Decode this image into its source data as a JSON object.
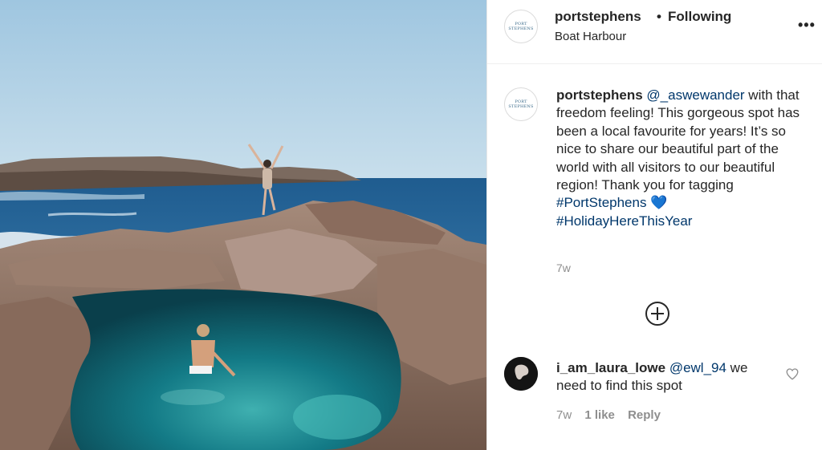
{
  "post": {
    "image_description_icon": "photo-icon"
  },
  "header": {
    "username": "portstephens",
    "separator": "•",
    "follow_status": "Following",
    "location": "Boat Harbour",
    "more_icon": "ellipsis-icon",
    "more_label": "•••",
    "avatar_text": "PORT STEPHENS"
  },
  "caption": {
    "username": "portstephens",
    "mention": "@_aswewander",
    "text_1": " with that freedom feeling! This gorgeous spot has been a local favourite for years! It’s so nice to share our beautiful part of the world with all visitors to our beautiful region! Thank you for tagging ",
    "hashtag_1": "#PortStephens",
    "heart": "💙",
    "hashtag_2": "#HolidayHereThisYear",
    "time": "7w"
  },
  "load_more_icon": "plus-circle-icon",
  "comment": {
    "username": "i_am_laura_lowe",
    "mention": "@ewl_94",
    "text": " we need to find this spot",
    "time": "7w",
    "likes": "1 like",
    "reply": "Reply",
    "like_icon": "heart-outline-icon"
  },
  "colors": {
    "link": "#00376b",
    "meta": "#8e8e8e",
    "text": "#262626",
    "heart_blue": "#3897f0"
  }
}
